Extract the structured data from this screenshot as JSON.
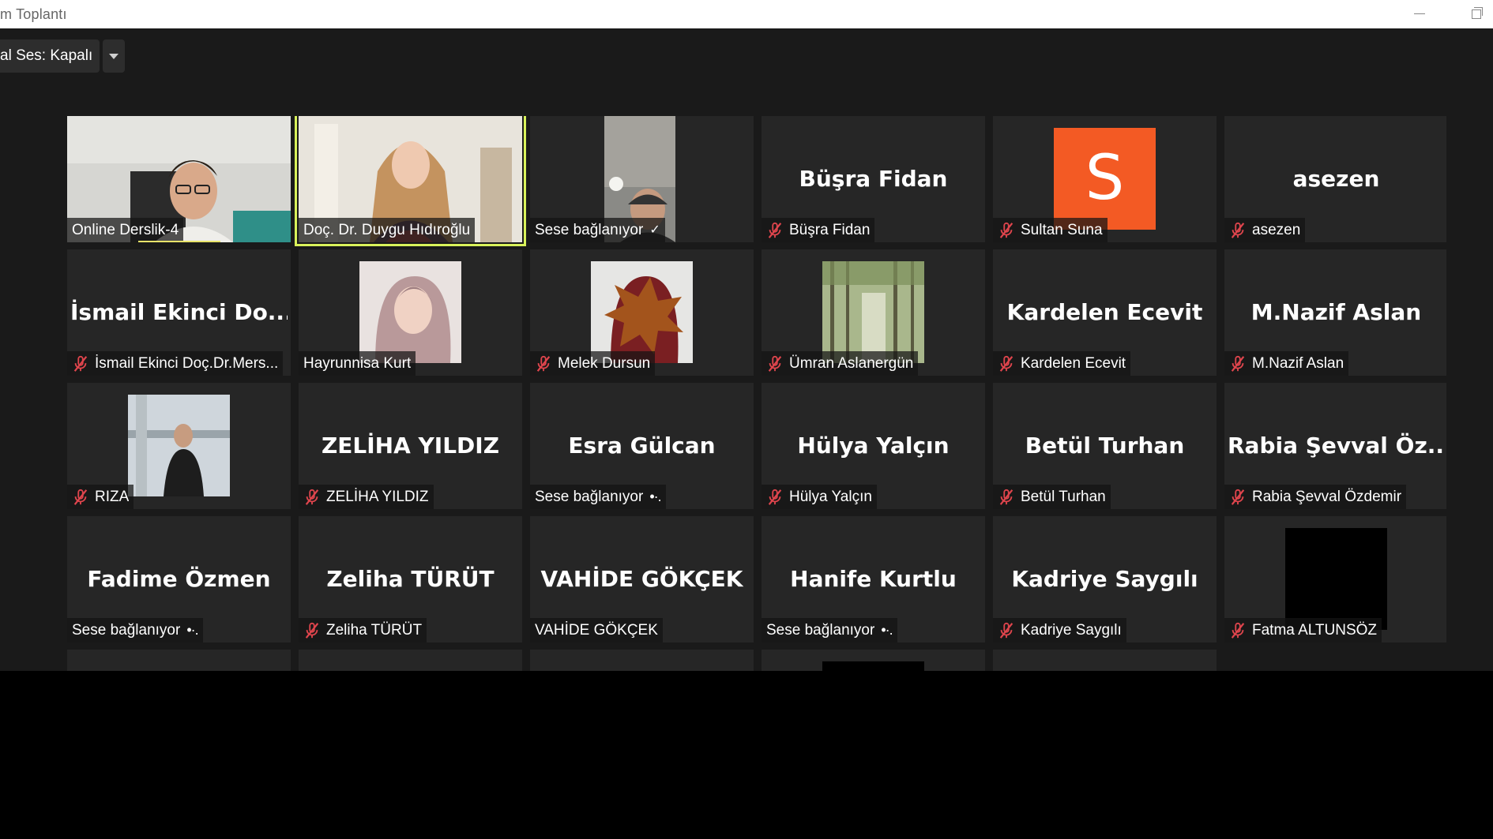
{
  "window": {
    "title": "m Toplantı"
  },
  "toolbar": {
    "audio_label": "al Ses: Kapalı"
  },
  "participants": [
    {
      "name": "Online Derslik-4",
      "display": "",
      "muted": false,
      "status": "",
      "kind": "video-man"
    },
    {
      "name": "Doç. Dr. Duygu Hıdıroğlu",
      "display": "",
      "muted": false,
      "status": "",
      "kind": "video-woman",
      "active": true
    },
    {
      "name": "Sese bağlanıyor",
      "display": "",
      "muted": false,
      "status": "check",
      "kind": "video-narrow"
    },
    {
      "name": "Büşra Fidan",
      "display": "Büşra Fidan",
      "muted": true,
      "status": ""
    },
    {
      "name": "Sultan Suna",
      "display": "",
      "muted": true,
      "status": "",
      "kind": "avatar-letter",
      "letter": "S",
      "color": "#f35a24"
    },
    {
      "name": "asezen",
      "display": "asezen",
      "muted": true,
      "status": ""
    },
    {
      "name": "İsmail Ekinci Doç.Dr.Mers...",
      "display": "İsmail Ekinci Do...",
      "muted": true,
      "status": ""
    },
    {
      "name": "Hayrunnisa Kurt",
      "display": "",
      "muted": false,
      "status": "",
      "kind": "photo-hijab"
    },
    {
      "name": "Melek Dursun",
      "display": "",
      "muted": true,
      "status": "",
      "kind": "photo-leaf"
    },
    {
      "name": "Ümran Aslanergün",
      "display": "",
      "muted": true,
      "status": "",
      "kind": "photo-forest"
    },
    {
      "name": "Kardelen Ecevit",
      "display": "Kardelen Ecevit",
      "muted": true,
      "status": ""
    },
    {
      "name": "M.Nazif Aslan",
      "display": "M.Nazif Aslan",
      "muted": true,
      "status": ""
    },
    {
      "name": "RIZA",
      "display": "",
      "muted": true,
      "status": "",
      "kind": "photo-bridge"
    },
    {
      "name": "ZELİHA YILDIZ",
      "display": "ZELİHA YILDIZ",
      "muted": true,
      "status": ""
    },
    {
      "name": "Sese bağlanıyor",
      "display": "Esra Gülcan",
      "muted": false,
      "status": "dots"
    },
    {
      "name": "Hülya Yalçın",
      "display": "Hülya Yalçın",
      "muted": true,
      "status": ""
    },
    {
      "name": "Betül Turhan",
      "display": "Betül Turhan",
      "muted": true,
      "status": ""
    },
    {
      "name": "Rabia Şevval Özdemir",
      "display": "Rabia Şevval Öz...",
      "muted": true,
      "status": ""
    },
    {
      "name": "Sese bağlanıyor",
      "display": "Fadime Özmen",
      "muted": false,
      "status": "dots"
    },
    {
      "name": "Zeliha TÜRÜT",
      "display": "Zeliha TÜRÜT",
      "muted": true,
      "status": ""
    },
    {
      "name": "VAHİDE GÖKÇEK",
      "display": "VAHİDE GÖKÇEK",
      "muted": false,
      "status": ""
    },
    {
      "name": "Sese bağlanıyor",
      "display": "Hanife Kurtlu",
      "muted": false,
      "status": "dots"
    },
    {
      "name": "Kadriye Saygılı",
      "display": "Kadriye Saygılı",
      "muted": true,
      "status": ""
    },
    {
      "name": "Fatma ALTUNSÖZ",
      "display": "",
      "muted": true,
      "status": "",
      "kind": "photo-black"
    },
    {
      "name": "",
      "display": "",
      "muted": false,
      "status": "",
      "kind": "empty"
    },
    {
      "name": "",
      "display": "",
      "muted": false,
      "status": "",
      "kind": "empty"
    },
    {
      "name": "",
      "display": "",
      "muted": false,
      "status": "",
      "kind": "empty"
    },
    {
      "name": "",
      "display": "",
      "muted": false,
      "status": "",
      "kind": "photo-black-top"
    },
    {
      "name": "",
      "display": "",
      "muted": false,
      "status": "",
      "kind": "empty"
    }
  ]
}
